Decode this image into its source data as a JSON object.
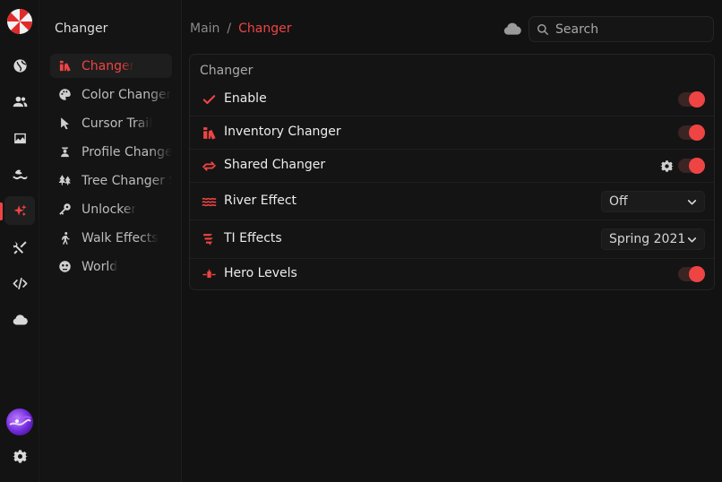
{
  "rail": {
    "items": [
      {
        "icon": "globe-icon"
      },
      {
        "icon": "users-icon"
      },
      {
        "icon": "image-icon"
      },
      {
        "icon": "river-icon"
      },
      {
        "icon": "sparkle-icon"
      },
      {
        "icon": "tools-icon"
      },
      {
        "icon": "code-icon"
      },
      {
        "icon": "cloud-icon"
      }
    ],
    "active_index": 4
  },
  "subnav": {
    "title": "Changer",
    "items": [
      {
        "label": "Changer",
        "icon": "inventory-icon",
        "active": true
      },
      {
        "label": "Color Changer",
        "icon": "palette-icon"
      },
      {
        "label": "Cursor Trail",
        "icon": "cursor-icon"
      },
      {
        "label": "Profile Changer",
        "icon": "profile-icon"
      },
      {
        "label": "Tree Changer Settings",
        "icon": "tree-icon"
      },
      {
        "label": "Unlocker",
        "icon": "key-icon"
      },
      {
        "label": "Walk Effects",
        "icon": "walk-icon"
      },
      {
        "label": "World",
        "icon": "world-icon"
      }
    ]
  },
  "breadcrumb": {
    "main": "Main",
    "separator": "/",
    "current": "Changer"
  },
  "search": {
    "placeholder": "Search"
  },
  "panel": {
    "title": "Changer",
    "rows": [
      {
        "label": "Enable",
        "icon": "check-icon",
        "control": "toggle",
        "on": true
      },
      {
        "label": "Inventory Changer",
        "icon": "inventory-icon",
        "control": "toggle",
        "on": true
      },
      {
        "label": "Shared Changer",
        "icon": "shared-icon",
        "control": "toggle",
        "on": true,
        "has_settings": true
      },
      {
        "label": "River Effect",
        "icon": "waves-icon",
        "control": "select",
        "value": "Off"
      },
      {
        "label": "TI Effects",
        "icon": "ti-icon",
        "control": "select",
        "value": "Spring 2021"
      },
      {
        "label": "Hero Levels",
        "icon": "hero-icon",
        "control": "toggle",
        "on": true
      }
    ]
  },
  "colors": {
    "accent": "#ef4444",
    "background": "#121212"
  }
}
